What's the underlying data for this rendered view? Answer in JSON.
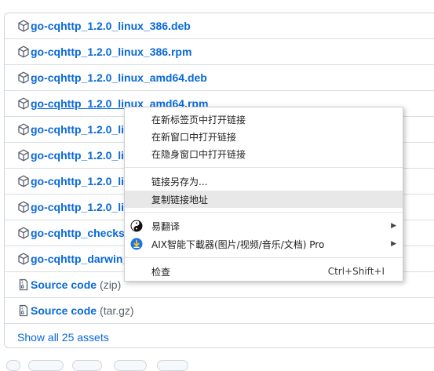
{
  "assets": [
    {
      "name": "go-cqhttp_1.2.0_linux_386.deb"
    },
    {
      "name": "go-cqhttp_1.2.0_linux_386.rpm"
    },
    {
      "name": "go-cqhttp_1.2.0_linux_amd64.deb"
    },
    {
      "name": "go-cqhttp_1.2.0_linux_amd64.rpm"
    },
    {
      "name": "go-cqhttp_1.2.0_linux_arm64.deb"
    },
    {
      "name": "go-cqhttp_1.2.0_linux_arm64.rpm"
    },
    {
      "name": "go-cqhttp_1.2.0_linux_armv7.deb"
    },
    {
      "name": "go-cqhttp_1.2.0_linux_armv7.rpm"
    },
    {
      "name": "go-cqhttp_checksums.txt"
    },
    {
      "name": "go-cqhttp_darwin_amd64.tar.gz"
    }
  ],
  "source_code": [
    {
      "label": "Source code",
      "suffix": "(zip)"
    },
    {
      "label": "Source code",
      "suffix": "(tar.gz)"
    }
  ],
  "show_all_label": "Show all 25 assets",
  "context_menu": {
    "items": [
      {
        "label": "在新标签页中打开链接"
      },
      {
        "label": "在新窗口中打开链接"
      },
      {
        "label": "在隐身窗口中打开链接"
      },
      {
        "label": "链接另存为..."
      },
      {
        "label": "复制链接地址"
      },
      {
        "label": "易翻译",
        "icon": "yin-yang-icon"
      },
      {
        "label": "AIX智能下載器(图片/视频/音乐/文档) Pro",
        "icon": "download-extension-icon"
      },
      {
        "label": "检查",
        "shortcut": "Ctrl+Shift+I"
      }
    ]
  }
}
